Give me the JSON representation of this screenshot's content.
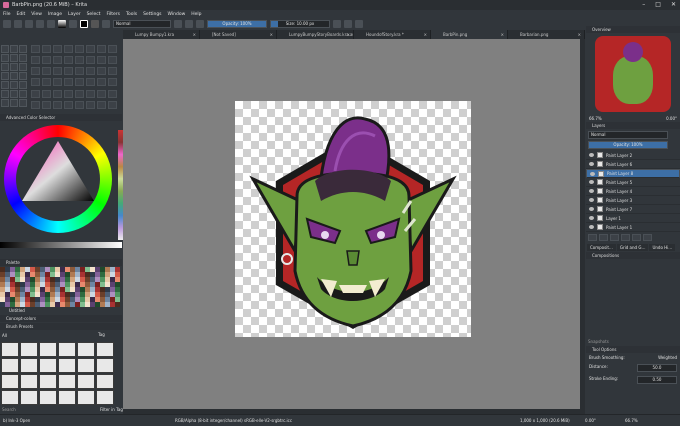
{
  "window": {
    "title": "BarbPin.png (20.6 MiB)  –  Krita"
  },
  "menu": [
    "File",
    "Edit",
    "View",
    "Image",
    "Layer",
    "Select",
    "Filters",
    "Tools",
    "Settings",
    "Window",
    "Help"
  ],
  "toolbar": {
    "blend_mode": "Normal",
    "opacity_label": "Opacity: 100%",
    "opacity_value": 100,
    "size_label": "Size: 10.00 px"
  },
  "tabs": [
    {
      "label": "Lumpy Bumpy1.kra"
    },
    {
      "label": "[Not Saved]"
    },
    {
      "label": "LumpyBumpyStoryBoards.kra.autosave.kra *"
    },
    {
      "label": "HoundofStory.kra *"
    },
    {
      "label": "BarbPin.png"
    },
    {
      "label": "Barbarian.png"
    }
  ],
  "left_panels": {
    "color_selector": "Advanced Color Selector",
    "palette": "Palette",
    "palette_name": "Untitled",
    "brush_presets": "Brush Presets",
    "brush_tag": "All",
    "tag_select": "Tag",
    "search": "Search",
    "filter_in_tag": "Filter in Tag"
  },
  "right_panels": {
    "overview": "Overview",
    "zoom": "66.7%",
    "rotation": "0.00°",
    "layers": "Layers",
    "blend_mode": "Normal",
    "opacity_label": "Opacity: 100%",
    "layers_list": [
      {
        "name": "Paint Layer 2",
        "selected": false
      },
      {
        "name": "Paint Layer 6",
        "selected": false
      },
      {
        "name": "Paint Layer 8",
        "selected": true
      },
      {
        "name": "Paint Layer 5",
        "selected": false
      },
      {
        "name": "Paint Layer 4",
        "selected": false
      },
      {
        "name": "Paint Layer 3",
        "selected": false
      },
      {
        "name": "Paint Layer 7",
        "selected": false
      },
      {
        "name": "Layer 1",
        "selected": false
      },
      {
        "name": "Paint Layer 1",
        "selected": false
      }
    ],
    "dock_tabs": [
      "Composit…",
      "Grid and G…",
      "Undo Hi…"
    ],
    "compositions": "Compositions",
    "snapshots": "Snapshots",
    "tool_options": "Tool Options",
    "brush_smoothing_label": "Brush Smoothing:",
    "brush_smoothing_value": "Weighted",
    "distance_label": "Distance:",
    "distance_value": "50.0",
    "stroke_ending_label": "Stroke Ending:",
    "stroke_ending_value": "0.50"
  },
  "status": {
    "brush": "b) Ink-3 Open",
    "color_info": "RGB/Alpha (8-bit integer/channel)  sRGB-elle-V2-srgbtrc.icc",
    "dims": "1,000 x 1,000 (20.6 MiB)",
    "rotation": "0.00°",
    "zoom": "66.7%"
  },
  "colors": {
    "accent": "#3d6fa6",
    "bg": "#31363b",
    "canvas_bg": "#808080"
  }
}
